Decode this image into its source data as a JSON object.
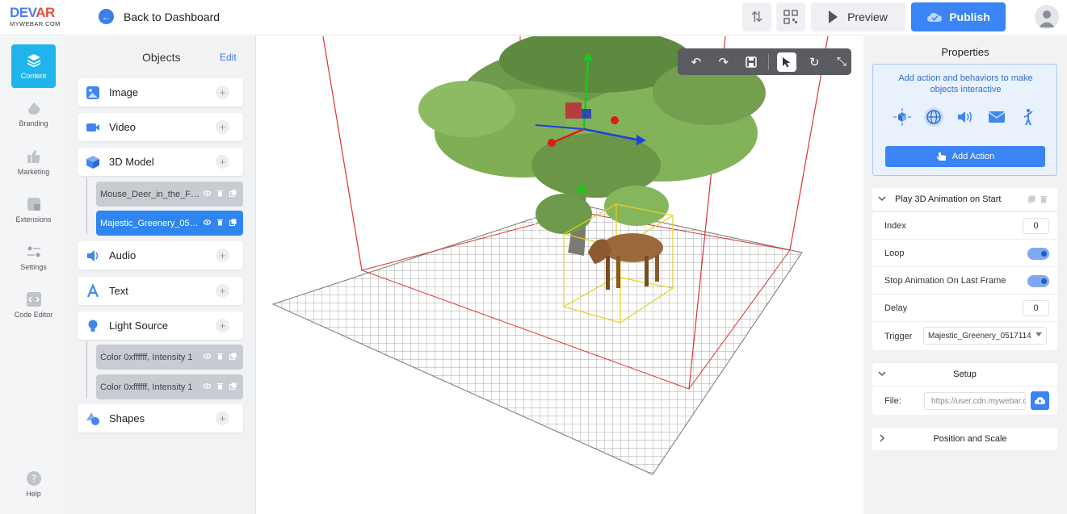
{
  "brand": {
    "logo_main_a": "DEV",
    "logo_main_b": "AR",
    "logo_sub": "MYWEBAR.COM"
  },
  "header": {
    "back_label": "Back to Dashboard",
    "preview_label": "Preview",
    "publish_label": "Publish"
  },
  "nav": {
    "items": [
      {
        "label": "Content",
        "active": true
      },
      {
        "label": "Branding"
      },
      {
        "label": "Marketing"
      },
      {
        "label": "Extensions"
      },
      {
        "label": "Settings"
      },
      {
        "label": "Code Editor"
      },
      {
        "label": "Help"
      }
    ]
  },
  "objects": {
    "title": "Objects",
    "edit_label": "Edit",
    "categories": [
      {
        "label": "Image"
      },
      {
        "label": "Video"
      },
      {
        "label": "3D Model"
      },
      {
        "label": "Audio"
      },
      {
        "label": "Text"
      },
      {
        "label": "Light Source"
      },
      {
        "label": "Shapes"
      }
    ],
    "models": [
      {
        "label": "Mouse_Deer_in_the_F…"
      },
      {
        "label": "Majestic_Greenery_05…",
        "selected": true
      }
    ],
    "lights": [
      {
        "label": "Color 0xffffff, Intensity 1"
      },
      {
        "label": "Color 0xffffff, Intensity 1"
      }
    ]
  },
  "properties": {
    "title": "Properties",
    "action_desc": "Add action and behaviors to make objects interactive",
    "add_action_label": "Add Action",
    "animation": {
      "title": "Play 3D Animation on Start",
      "index_label": "Index",
      "index_value": "0",
      "loop_label": "Loop",
      "loop_on": true,
      "stop_label": "Stop Animation On Last Frame",
      "stop_on": true,
      "delay_label": "Delay",
      "delay_value": "0",
      "trigger_label": "Trigger",
      "trigger_value": "Majestic_Greenery_0517114"
    },
    "setup": {
      "title": "Setup",
      "file_label": "File:",
      "file_value": "https://user.cdn.mywebar.com"
    },
    "position": {
      "title": "Position and Scale"
    }
  },
  "colors": {
    "accent": "#3a84f5",
    "nav_active": "#1fb5ec",
    "selected_row": "#2f86f0"
  }
}
